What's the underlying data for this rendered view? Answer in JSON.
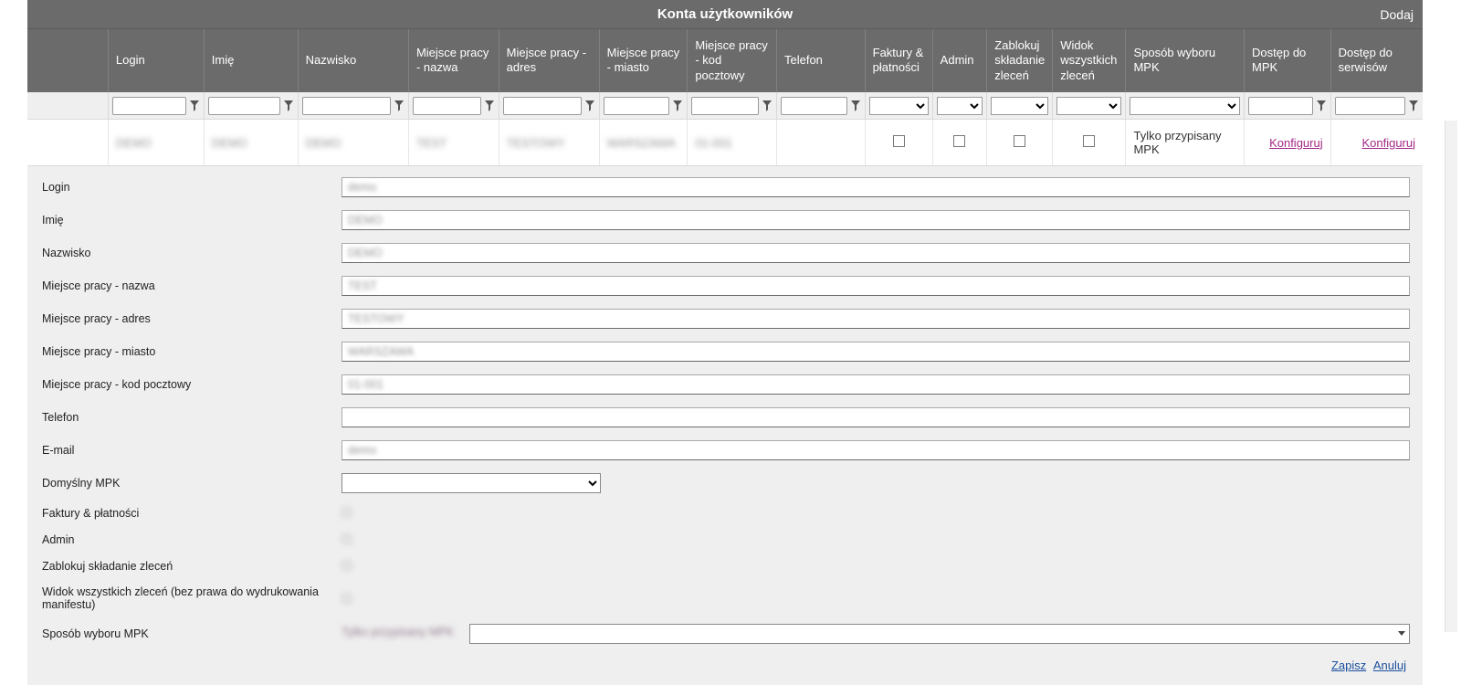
{
  "title": "Konta użytkowników",
  "add_label": "Dodaj",
  "cfg_label": "Konfiguruj",
  "columns": {
    "login": "Login",
    "imie": "Imię",
    "nazwisko": "Nazwisko",
    "mp_nazwa": "Miejsce pracy - nazwa",
    "mp_adres": "Miejsce pracy - adres",
    "mp_miasto": "Miejsce pracy - miasto",
    "mp_kod": "Miejsce pracy - kod pocztowy",
    "telefon": "Telefon",
    "faktury": "Faktury & płatności",
    "admin": "Admin",
    "zablokuj": "Zablokuj składanie zleceń",
    "widok": "Widok wszystkich zleceń",
    "sposob": "Sposób wyboru MPK",
    "dostep_mpk": "Dostęp do MPK",
    "dostep_serwisow": "Dostęp do serwisów"
  },
  "row": {
    "login": "DEMO",
    "imie": "DEMO",
    "nazwisko": "DEMO",
    "mp_nazwa": "TEST",
    "mp_adres": "TESTOWY",
    "mp_miasto": "WARSZAWA",
    "mp_kod": "01-001",
    "telefon": "",
    "faktury": false,
    "admin": false,
    "zablokuj": false,
    "widok": false,
    "sposob": "Tylko przypisany MPK"
  },
  "form": {
    "labels": {
      "login": "Login",
      "imie": "Imię",
      "nazwisko": "Nazwisko",
      "mp_nazwa": "Miejsce pracy - nazwa",
      "mp_adres": "Miejsce pracy - adres",
      "mp_miasto": "Miejsce pracy - miasto",
      "mp_kod": "Miejsce pracy - kod pocztowy",
      "telefon": "Telefon",
      "email": "E-mail",
      "domyslny_mpk": "Domyślny MPK",
      "faktury": "Faktury & płatności",
      "admin": "Admin",
      "zablokuj": "Zablokuj składanie zleceń",
      "widok": "Widok wszystkich zleceń (bez prawa do wydrukowania manifestu)",
      "sposob_mpk": "Sposób wyboru MPK"
    },
    "values": {
      "login": "demo",
      "imie": "DEMO",
      "nazwisko": "DEMO",
      "mp_nazwa": "TEST",
      "mp_adres": "TESTOWY",
      "mp_miasto": "WARSZAWA",
      "mp_kod": "01-001",
      "telefon": "",
      "email": "demo",
      "sposob_mpk": "Tylko przypisany MPK"
    }
  },
  "actions": {
    "save": "Zapisz",
    "cancel": "Anuluj"
  }
}
